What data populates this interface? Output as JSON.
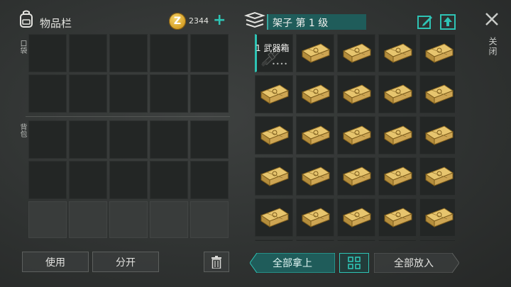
{
  "inventory": {
    "title": "物品栏",
    "pocket_label": "口袋",
    "backpack_label": "背包",
    "coin_icon_glyph": "Z",
    "coins": "2344",
    "add_glyph": "+"
  },
  "buttons": {
    "use": "使用",
    "split": "分开"
  },
  "shelf": {
    "title": "架子 第 1 级",
    "close_label": "关闭",
    "take_all": "全部拿上",
    "put_all": "全部放入",
    "first_item_label": "1 武器箱",
    "first_item_dots": "••••"
  },
  "colors": {
    "accent": "#2ec3b4",
    "shelf_bar": "#1f5c5a",
    "crate_gold": "#d6b25c"
  }
}
